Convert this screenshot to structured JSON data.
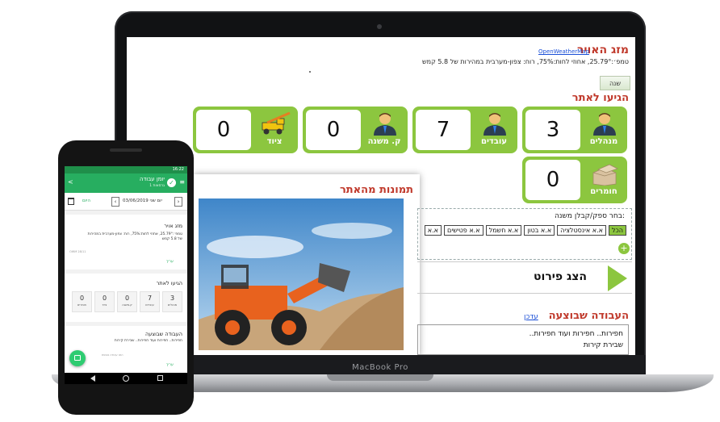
{
  "laptop": {
    "brand": "MacBook Pro",
    "weather": {
      "title": "מזג האויר",
      "link": "OpenWeatherMap",
      "text": "טמפ׳:25.79°, אחוזי לחות:75%, רוח: צפון-מערבית במהירות של 5.8 קמש"
    },
    "year_button": "שנה",
    "arrived": {
      "title": "הגיעו לאתר",
      "cards": [
        {
          "label": "מנהלים",
          "value": "3",
          "icon": "manager-icon"
        },
        {
          "label": "עובדים",
          "value": "7",
          "icon": "worker-icon"
        },
        {
          "label": "ק. משנה",
          "value": "0",
          "icon": "subcontractor-icon"
        },
        {
          "label": "ציוד",
          "value": "0",
          "icon": "crane-icon"
        },
        {
          "label": "חומרים",
          "value": "0",
          "icon": "materials-icon"
        }
      ]
    },
    "photos": {
      "title": "תמונות מהאתר"
    },
    "contractor": {
      "label": "בחר ספק/קבלן משנה:",
      "tags": [
        "הכל",
        "א.א אינסטלציה",
        "א.א בטון",
        "א.א חשמל",
        "א.א פטישים",
        "א.א"
      ],
      "add": "+"
    },
    "details": {
      "label": "הצג פירוט"
    },
    "work_done": {
      "title": "העבודה שבוצעה",
      "update_link": "עדכן",
      "lines": [
        "חפירות.. חפירות ועוד חפירות..",
        "שבירת קירות"
      ]
    }
  },
  "phone": {
    "status_time": "16:22",
    "app_title": "יומן עבודה",
    "app_subtitle": "גרסאות 1",
    "date": {
      "today": "היום",
      "text": "יום שני 03/06/2019"
    },
    "weather": {
      "title": "מזג אויר",
      "text": "טמפ׳:25.79°, אחוזי לחות:75%, רוח: צפון-מערבית במהירות של 5.8 קמש",
      "small": "OWM 28/11",
      "edit": "עריך"
    },
    "arrived": {
      "title": "הגיעו לאתר",
      "cards": [
        {
          "label": "מנהלים",
          "value": "3"
        },
        {
          "label": "עובדים",
          "value": "7"
        },
        {
          "label": "ק.משנה",
          "value": "0"
        },
        {
          "label": "ציוד",
          "value": "0"
        },
        {
          "label": "חומרים",
          "value": "0"
        }
      ]
    },
    "work": {
      "title": "העבודה שבוצעה",
      "text": "חפירות.. חפירות ועוד חפירות.. שבירת קירות",
      "small": "הזנו עבודה נוספת",
      "edit": "עריך"
    }
  },
  "colors": {
    "accent": "#8cc63f",
    "title_red": "#c0392b",
    "app_green": "#27ae60"
  }
}
